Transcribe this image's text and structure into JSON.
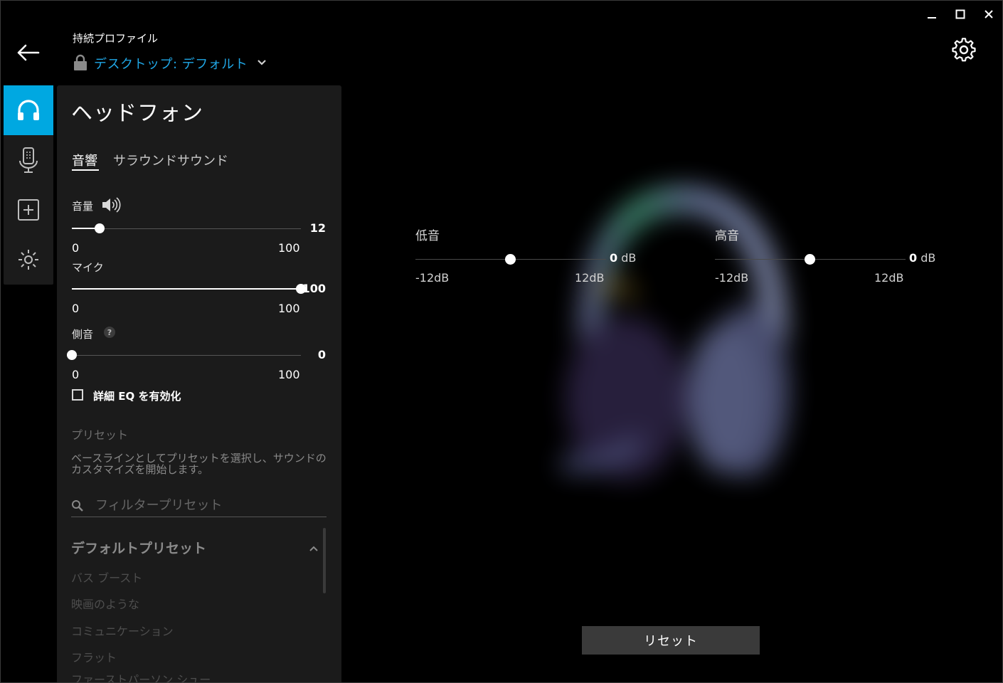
{
  "window": {
    "minimize_icon": "minimize-icon",
    "maximize_icon": "maximize-icon",
    "close_icon": "close-icon"
  },
  "header": {
    "profile_caption": "持続プロファイル",
    "profile_name": "デスクトップ: デフォルト",
    "back_icon": "arrow-left-icon",
    "lock_icon": "lock-icon",
    "chevron_icon": "chevron-down-icon",
    "settings_icon": "gear-icon"
  },
  "rail": {
    "items": [
      {
        "icon": "headphones-icon",
        "active": true
      },
      {
        "icon": "microphone-icon",
        "active": false
      },
      {
        "icon": "add-square-icon",
        "active": false
      },
      {
        "icon": "brightness-icon",
        "active": false
      }
    ]
  },
  "panel": {
    "title": "ヘッドフォン",
    "tabs": [
      {
        "label": "音響",
        "active": true
      },
      {
        "label": "サラウンドサウンド",
        "active": false
      }
    ],
    "sliders": [
      {
        "label": "音量",
        "value": "12",
        "level": 12,
        "min": "0",
        "max": "100",
        "icon": "speaker-icon"
      },
      {
        "label": "マイク",
        "value": "100",
        "level": 100,
        "min": "0",
        "max": "100"
      },
      {
        "label": "側音",
        "value": "0",
        "level": 0,
        "min": "0",
        "max": "100",
        "help": "?"
      }
    ],
    "advanced_eq_label": "詳細 EQ を有効化",
    "advanced_eq_checked": false,
    "preset_heading": "プリセット",
    "preset_description": "ベースラインとしてプリセットを選択し、サウンドのカスタマイズを開始します。",
    "search_placeholder": "フィルタープリセット",
    "search_value": "",
    "group_title": "デフォルトプリセット",
    "presets": [
      "バス ブースト",
      "映画のような",
      "コミュニケーション",
      "フラット",
      "ファーストパーソン シュー"
    ]
  },
  "eq": {
    "bass": {
      "label": "低音",
      "value": "0",
      "unit": "dB",
      "min": "-12dB",
      "max": "12dB"
    },
    "treble": {
      "label": "高音",
      "value": "0",
      "unit": "dB",
      "min": "-12dB",
      "max": "12dB"
    }
  },
  "reset_label": "リセット",
  "colors": {
    "accent": "#00a8e1",
    "profile_link": "#20a7e6",
    "panel_bg": "#1b1b1b",
    "background": "#000000"
  }
}
